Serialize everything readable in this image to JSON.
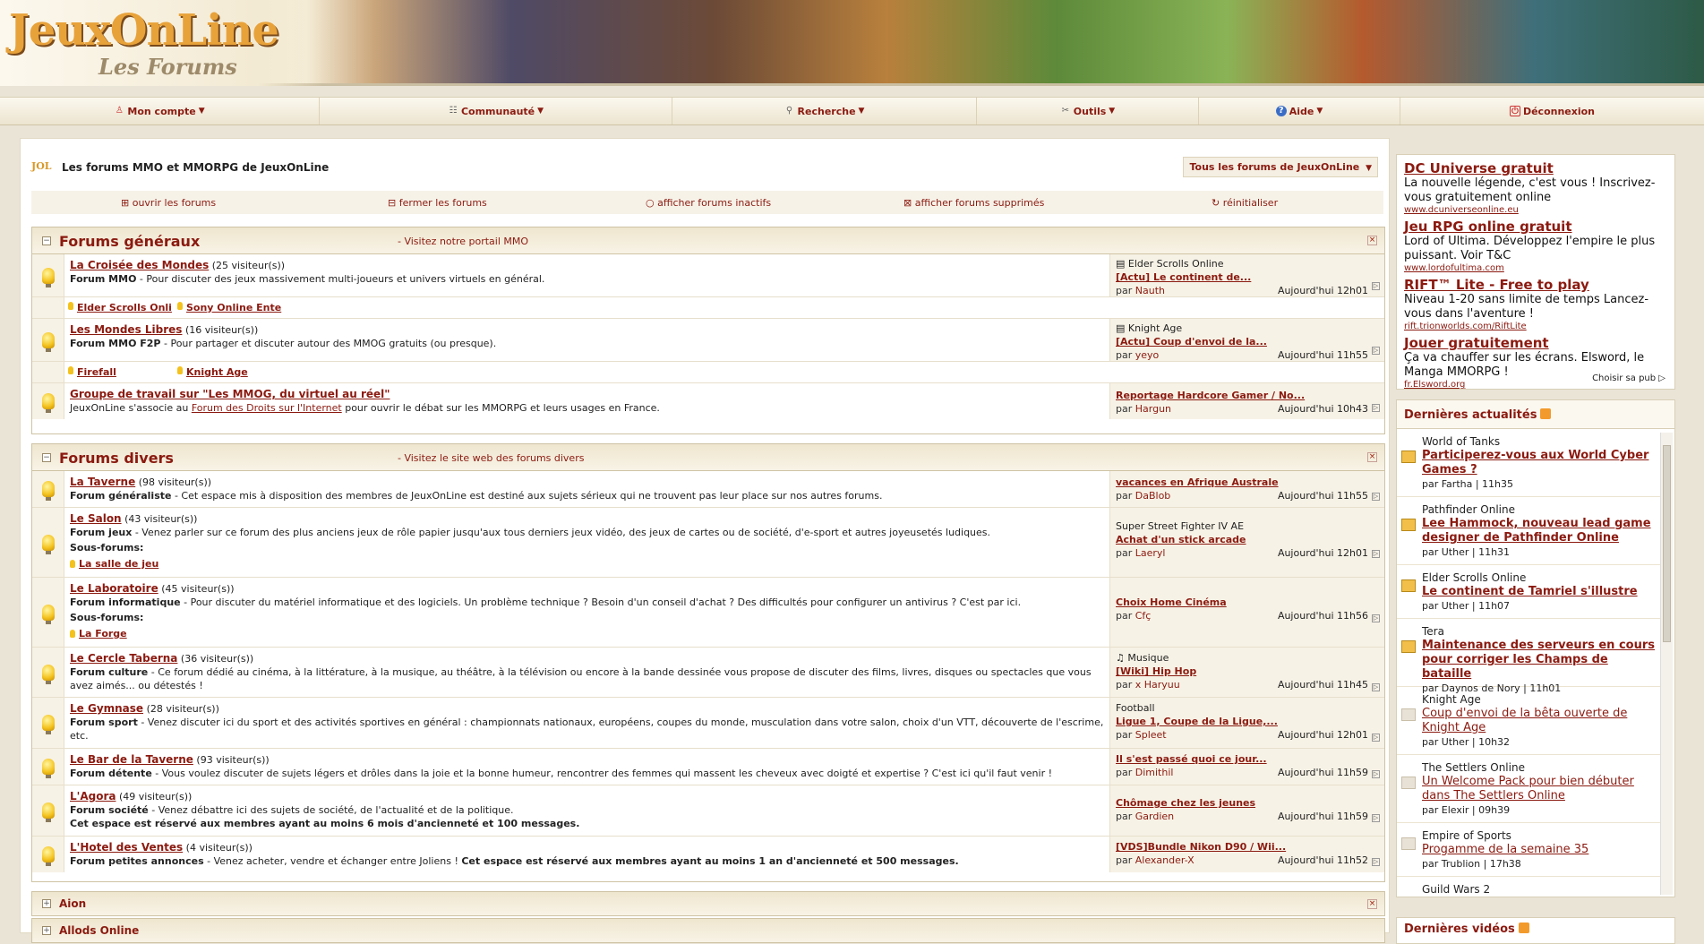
{
  "brand": {
    "logo": "JeuxOnLine",
    "sub": "Les Forums"
  },
  "nav": [
    {
      "label": "Mon compte",
      "icon": "user-icon"
    },
    {
      "label": "Communauté",
      "icon": "community-icon"
    },
    {
      "label": "Recherche",
      "icon": "search-icon"
    },
    {
      "label": "Outils",
      "icon": "tools-icon"
    },
    {
      "label": "Aide",
      "icon": "help-icon"
    },
    {
      "label": "Déconnexion",
      "icon": "logout-icon"
    }
  ],
  "page": {
    "title": "Les forums MMO et MMORPG de JeuxOnLine",
    "forum_select": "Tous les forums de JeuxOnLine",
    "options": [
      "ouvrir les forums",
      "fermer les forums",
      "afficher forums inactifs",
      "afficher forums supprimés",
      "réinitialiser"
    ]
  },
  "sections": {
    "general": {
      "title": "Forums généraux",
      "link": "- Visitez notre portail MMO",
      "forums": [
        {
          "name": "La Croisée des Mondes",
          "visitors": "(25 visiteur(s))",
          "type": "Forum MMO",
          "desc": " - Pour discuter des jeux massivement multi-joueurs et univers virtuels en général.",
          "last_cat": "Elder Scrolls Online",
          "last_topic": "[Actu] Le continent de...",
          "last_user": "Nauth",
          "last_time": "Aujourd'hui 12h01"
        },
        {
          "name": "Les Mondes Libres",
          "visitors": "(16 visiteur(s))",
          "type": "Forum MMO F2P",
          "desc": " - Pour partager et discuter autour des MMOG gratuits (ou presque).",
          "last_cat": "Knight Age",
          "last_topic": "[Actu] Coup d'envoi de la...",
          "last_user": "yeyo",
          "last_time": "Aujourd'hui 11h55"
        },
        {
          "name": "Groupe de travail sur \"Les MMOG, du virtuel au réel\"",
          "desc_a": "JeuxOnLine s'associe au ",
          "desc_link": "Forum des Droits sur l'Internet",
          "desc_b": " pour ouvrir le débat sur les MMORPG et leurs usages en France.",
          "last_topic": "Reportage Hardcore Gamer / No...",
          "last_user": "Hargun",
          "last_time": "Aujourd'hui 10h43"
        }
      ],
      "sub1": [
        "Elder Scrolls Onli",
        "Sony Online Ente"
      ],
      "sub2": [
        "Firefall",
        "Knight Age"
      ]
    },
    "divers": {
      "title": "Forums divers",
      "link": "- Visitez le site web des forums divers",
      "forums": [
        {
          "name": "La Taverne",
          "visitors": "(98 visiteur(s))",
          "type": "Forum généraliste",
          "desc": " - Cet espace mis à disposition des membres de JeuxOnLine est destiné aux sujets sérieux qui ne trouvent pas leur place sur nos autres forums.",
          "last_topic": "vacances en Afrique Australe",
          "last_user": "DaBlob",
          "last_time": "Aujourd'hui 11h55"
        },
        {
          "name": "Le Salon",
          "visitors": "(43 visiteur(s))",
          "type": "Forum jeux",
          "desc": " - Venez parler sur ce forum des plus anciens jeux de rôle papier jusqu'aux tous derniers jeux vidéo, des jeux de cartes ou de société, d'e-sport et autres joyeusetés ludiques.",
          "sub_label": "Sous-forums:",
          "sub": "La salle de jeu",
          "last_cat": "Super Street Fighter IV AE",
          "last_topic": "Achat d'un stick arcade",
          "last_user": "Laeryl",
          "last_time": "Aujourd'hui 12h01"
        },
        {
          "name": "Le Laboratoire",
          "visitors": "(45 visiteur(s))",
          "type": "Forum informatique",
          "desc": " - Pour discuter du matériel informatique et des logiciels. Un problème technique ? Besoin d'un conseil d'achat ? Des difficultés pour configurer un antivirus ? C'est par ici.",
          "sub_label": "Sous-forums:",
          "sub": "La Forge",
          "last_topic": "Choix Home Cinéma",
          "last_user": "Cfç",
          "last_time": "Aujourd'hui 11h56"
        },
        {
          "name": "Le Cercle Taberna",
          "visitors": "(36 visiteur(s))",
          "type": "Forum culture",
          "desc": " - Ce forum dédié au cinéma, à la littérature, à la musique, au théâtre, à la télévision ou encore à la bande dessinée vous propose de discuter des films, livres, disques ou spectacles que vous avez aimés... ou détestés !",
          "last_cat": "Musique",
          "last_topic": "[Wiki] Hip Hop",
          "last_user": "x Haryuu",
          "last_time": "Aujourd'hui 11h45"
        },
        {
          "name": "Le Gymnase",
          "visitors": "(28 visiteur(s))",
          "type": "Forum sport",
          "desc": " - Venez discuter ici du sport et des activités sportives en général : championnats nationaux, européens, coupes du monde, musculation dans votre salon, choix d'un VTT, découverte de l'escrime, etc.",
          "last_cat": "Football",
          "last_topic": "Ligue 1, Coupe de la Ligue,...",
          "last_user": "Spleet",
          "last_time": "Aujourd'hui 12h01"
        },
        {
          "name": "Le Bar de la Taverne",
          "visitors": "(93 visiteur(s))",
          "type": "Forum détente",
          "desc": " - Vous voulez discuter de sujets légers et drôles dans la joie et la bonne humeur, rencontrer des femmes qui massent les cheveux avec doigté et expertise ? C'est ici qu'il faut venir !",
          "last_topic": "Il s'est passé quoi ce jour...",
          "last_user": "Dimithil",
          "last_time": "Aujourd'hui 11h59"
        },
        {
          "name": "L'Agora",
          "visitors": "(49 visiteur(s))",
          "type": "Forum société",
          "desc": " - Venez débattre ici des sujets de société, de l'actualité et de la politique.",
          "note": "Cet espace est réservé aux membres ayant au moins 6 mois d'ancienneté et 100 messages.",
          "last_topic": "Chômage chez les jeunes",
          "last_user": "Gardien",
          "last_time": "Aujourd'hui 11h59"
        },
        {
          "name": "L'Hotel des Ventes",
          "visitors": "(4 visiteur(s))",
          "type": "Forum petites annonces",
          "desc": " - Venez acheter, vendre et échanger entre Joliens ! ",
          "note": "Cet espace est réservé aux membres ayant au moins 1 an d'ancienneté et 500 messages.",
          "last_topic": "[VDS]Bundle Nikon D90 / Wii...",
          "last_user": "Alexander-X",
          "last_time": "Aujourd'hui 11h52"
        }
      ]
    },
    "collapsed": [
      "Aion",
      "Allods Online"
    ]
  },
  "ads": [
    {
      "title": "DC Universe gratuit",
      "body": "La nouvelle légende, c'est vous ! Inscrivez-vous gratuitement online",
      "url": "www.dcuniverseonline.eu"
    },
    {
      "title": "Jeu RPG online gratuit",
      "body": "Lord of Ultima. Développez l'empire le plus puissant. Voir T&C",
      "url": "www.lordofultima.com"
    },
    {
      "title": "RIFT™ Lite - Free to play",
      "body": "Niveau 1-20 sans limite de temps Lancez-vous dans l'aventure !",
      "url": "rift.trionworlds.com/RiftLite"
    },
    {
      "title": "Jouer gratuitement",
      "body": "Ça va chauffer sur les écrans. Elsword, le Manga MMORPG !",
      "url": "fr.Elsword.org"
    }
  ],
  "ads_choose": "Choisir sa pub",
  "news": {
    "title": "Dernières actualités",
    "items": [
      {
        "cat": "World of Tanks",
        "title": "Participerez-vous aux World Cyber Games ?",
        "by": "par Fartha | 11h35",
        "fresh": true
      },
      {
        "cat": "Pathfinder Online",
        "title": "Lee Hammock, nouveau lead game designer de Pathfinder Online",
        "by": "par Uther | 11h31",
        "fresh": true
      },
      {
        "cat": "Elder Scrolls Online",
        "title": "Le continent de Tamriel s'illustre",
        "by": "par Uther | 11h07",
        "fresh": true
      },
      {
        "cat": "Tera",
        "title": "Maintenance des serveurs en cours pour corriger les Champs de bataille",
        "by": "par Daynos de Nory | 11h01",
        "fresh": true
      },
      {
        "cat": "Knight Age",
        "title": "Coup d'envoi de la bêta ouverte de Knight Age",
        "by": "par Uther | 10h32",
        "fresh": false
      },
      {
        "cat": "The Settlers Online",
        "title": "Un Welcome Pack pour bien débuter dans The Settlers Online",
        "by": "par Elexir | 09h39",
        "fresh": false
      },
      {
        "cat": "Empire of Sports",
        "title": "Progamme de la semaine 35",
        "by": "par Trublion | 17h38",
        "fresh": false
      },
      {
        "cat": "Guild Wars 2",
        "title": "",
        "by": "",
        "fresh": false
      }
    ]
  },
  "videos": {
    "title": "Dernières vidéos"
  }
}
